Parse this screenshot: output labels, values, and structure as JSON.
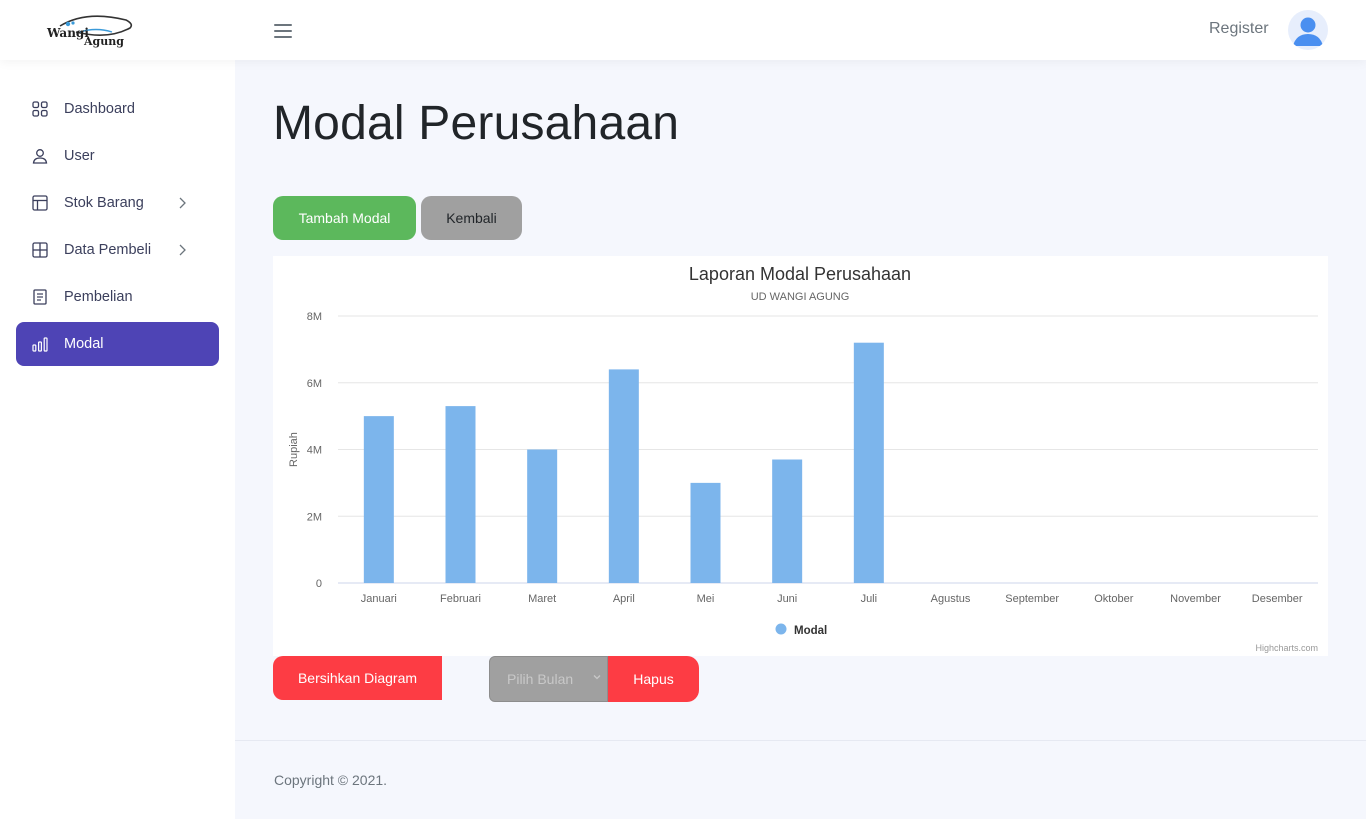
{
  "header": {
    "logo_text_top": "Wangi",
    "logo_text_bottom": "Agung",
    "register_label": "Register"
  },
  "sidebar": {
    "items": [
      {
        "label": "Dashboard",
        "icon": "grid-icon"
      },
      {
        "label": "User",
        "icon": "user-icon"
      },
      {
        "label": "Stok Barang",
        "icon": "layout-icon",
        "has_submenu": true
      },
      {
        "label": "Data Pembeli",
        "icon": "table-icon",
        "has_submenu": true
      },
      {
        "label": "Pembelian",
        "icon": "document-icon"
      },
      {
        "label": "Modal",
        "icon": "bar-chart-icon",
        "active": true
      }
    ]
  },
  "main": {
    "title": "Modal Perusahaan",
    "add_button": "Tambah Modal",
    "back_button": "Kembali",
    "clear_button": "Bersihkan Diagram",
    "month_select_placeholder": "Pilih Bulan",
    "delete_button": "Hapus"
  },
  "footer": {
    "copyright": "Copyright © 2021."
  },
  "colors": {
    "primary_active": "#4e44b5",
    "green": "#5cb85c",
    "grey": "#a0a0a0",
    "red": "#fd3c44",
    "bar": "#7cb5ec"
  },
  "chart_data": {
    "type": "bar",
    "title": "Laporan Modal Perusahaan",
    "subtitle": "UD WANGI AGUNG",
    "ylabel": "Rupiah",
    "xlabel": "",
    "categories": [
      "Januari",
      "Februari",
      "Maret",
      "April",
      "Mei",
      "Juni",
      "Juli",
      "Agustus",
      "September",
      "Oktober",
      "November",
      "Desember"
    ],
    "series": [
      {
        "name": "Modal",
        "values": [
          5000000,
          5300000,
          4000000,
          6400000,
          3000000,
          3700000,
          7200000,
          null,
          null,
          null,
          null,
          null
        ]
      }
    ],
    "ylim": [
      0,
      8000000
    ],
    "yticks": [
      "0",
      "2M",
      "4M",
      "6M",
      "8M"
    ],
    "ytick_values": [
      0,
      2000000,
      4000000,
      6000000,
      8000000
    ],
    "grid": true,
    "legend": "bottom-center",
    "credits": "Highcharts.com"
  }
}
